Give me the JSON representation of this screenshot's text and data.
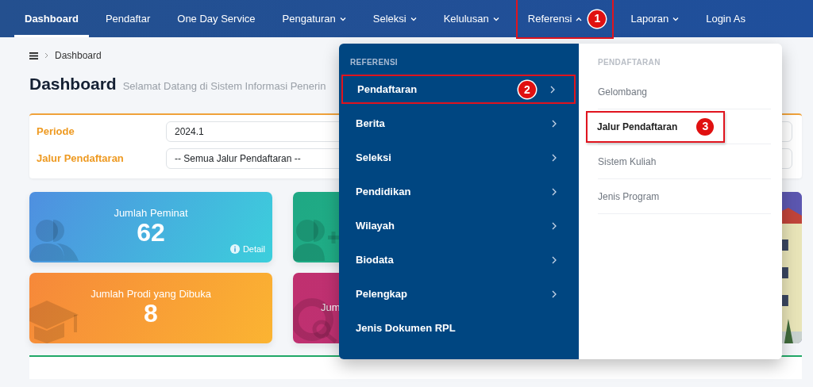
{
  "navbar": {
    "items": [
      {
        "label": "Dashboard",
        "selected": true,
        "dropdown": false
      },
      {
        "label": "Pendaftar",
        "selected": false,
        "dropdown": false
      },
      {
        "label": "One Day Service",
        "selected": false,
        "dropdown": false
      },
      {
        "label": "Pengaturan",
        "selected": false,
        "dropdown": true,
        "expanded": false
      },
      {
        "label": "Seleksi",
        "selected": false,
        "dropdown": true,
        "expanded": false
      },
      {
        "label": "Kelulusan",
        "selected": false,
        "dropdown": true,
        "expanded": false
      },
      {
        "label": "Referensi",
        "selected": false,
        "dropdown": true,
        "expanded": true,
        "annotation": "1"
      },
      {
        "label": "Laporan",
        "selected": false,
        "dropdown": true,
        "expanded": false
      },
      {
        "label": "Login As",
        "selected": false,
        "dropdown": false
      }
    ]
  },
  "breadcrumb": {
    "current": "Dashboard"
  },
  "page": {
    "title": "Dashboard",
    "subtitle": "Selamat Datang di Sistem Informasi Penerin"
  },
  "filters": [
    {
      "label": "Periode",
      "value": "2024.1"
    },
    {
      "label": "Jalur Pendaftaran",
      "value": "-- Semua Jalur Pendaftaran --"
    }
  ],
  "stat_cards": [
    {
      "kind": "blue",
      "title": "Jumlah Peminat",
      "value": "62",
      "link": "Detail"
    },
    {
      "kind": "green"
    },
    {
      "kind": "orange",
      "title": "Jumlah Prodi yang Dibuka",
      "value": "8"
    },
    {
      "kind": "magenta",
      "title": "Jum"
    }
  ],
  "referensi_menu": {
    "heading": "REFERENSI",
    "items": [
      {
        "label": "Pendaftaran",
        "submenu": true,
        "annotation": "2"
      },
      {
        "label": "Berita",
        "submenu": true
      },
      {
        "label": "Seleksi",
        "submenu": true
      },
      {
        "label": "Pendidikan",
        "submenu": true
      },
      {
        "label": "Wilayah",
        "submenu": true
      },
      {
        "label": "Biodata",
        "submenu": true
      },
      {
        "label": "Pelengkap",
        "submenu": true
      },
      {
        "label": "Jenis Dokumen RPL",
        "submenu": false
      }
    ],
    "submenu": {
      "heading": "PENDAFTARAN",
      "items": [
        {
          "label": "Gelombang",
          "selected": false
        },
        {
          "label": "Jalur Pendaftaran",
          "selected": true,
          "annotation": "3"
        },
        {
          "label": "Sistem Kuliah",
          "selected": false
        },
        {
          "label": "Jenis Program",
          "selected": false
        }
      ]
    }
  }
}
